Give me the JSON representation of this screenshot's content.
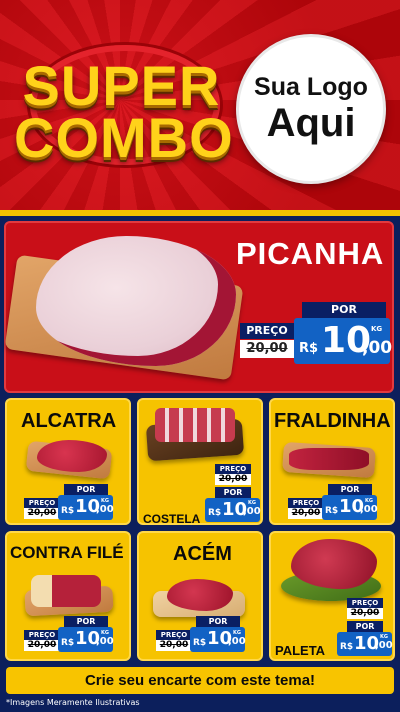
{
  "header": {
    "title_line1": "SUPER",
    "title_line2": "COMBO",
    "logo_line1": "Sua Logo",
    "logo_line2": "Aqui"
  },
  "labels": {
    "preco": "PREÇO",
    "por": "POR",
    "currency": "R$",
    "unit": "KG"
  },
  "main_product": {
    "name": "PICANHA",
    "old_price": "20,00",
    "price_int": "10",
    "price_dec": ",00"
  },
  "products": [
    {
      "name": "ALCATRA",
      "old_price": "20,00",
      "price_int": "10",
      "price_dec": ",00"
    },
    {
      "name": "COSTELA",
      "old_price": "20,00",
      "price_int": "10",
      "price_dec": ",00"
    },
    {
      "name": "FRALDINHA",
      "old_price": "20,00",
      "price_int": "10",
      "price_dec": ",00"
    },
    {
      "name": "CONTRA FILÉ",
      "old_price": "20,00",
      "price_int": "10",
      "price_dec": ",00"
    },
    {
      "name": "ACÉM",
      "old_price": "20,00",
      "price_int": "10",
      "price_dec": ",00"
    },
    {
      "name": "PALETA",
      "old_price": "20,00",
      "price_int": "10",
      "price_dec": ",00"
    }
  ],
  "footer": {
    "cta": "Crie seu encarte com este tema!",
    "disclaimer": "*Imagens Meramente Ilustrativas"
  },
  "colors": {
    "red": "#c90f18",
    "yellow": "#f6c300",
    "navy": "#0c1f5c",
    "price_blue": "#1262c4"
  }
}
